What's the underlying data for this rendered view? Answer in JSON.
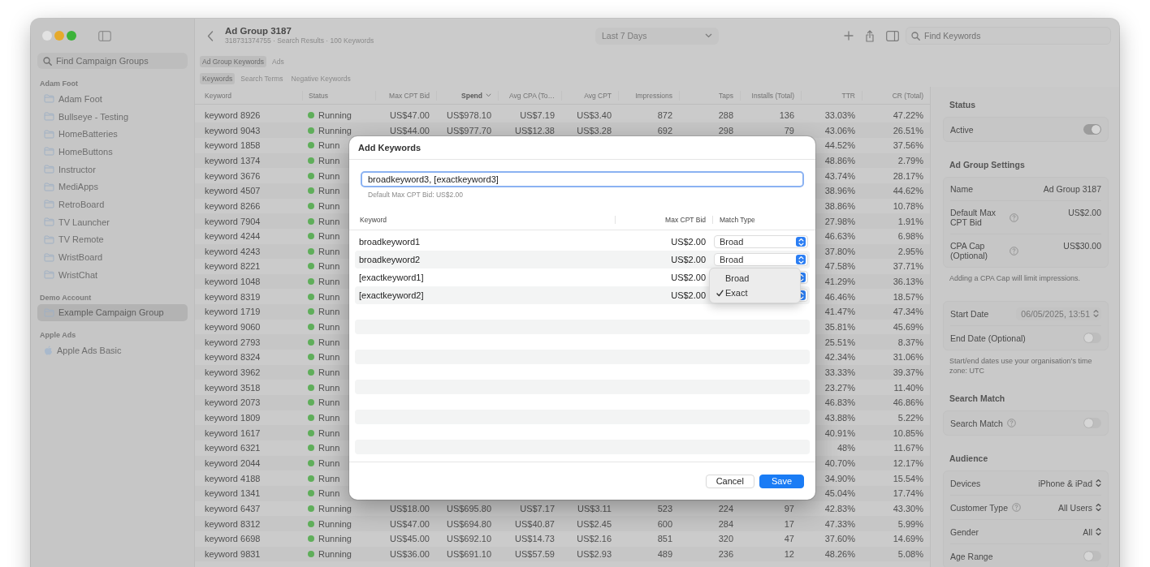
{
  "window": {
    "title": "Ad Group 3187",
    "subtitle": "318731374755 · Search Results · 100 Keywords"
  },
  "sidebar": {
    "search": {
      "placeholder": "Find Campaign Groups"
    },
    "sections": [
      {
        "title": "Adam Foot",
        "items": [
          {
            "label": "Adam Foot",
            "kind": "folder",
            "selected": false
          },
          {
            "label": "Bullseye - Testing",
            "kind": "folder",
            "selected": false
          },
          {
            "label": "HomeBatteries",
            "kind": "folder",
            "selected": false
          },
          {
            "label": "HomeButtons",
            "kind": "folder",
            "selected": false
          },
          {
            "label": "Instructor",
            "kind": "folder",
            "selected": false
          },
          {
            "label": "MediApps",
            "kind": "folder",
            "selected": false
          },
          {
            "label": "RetroBoard",
            "kind": "folder",
            "selected": false
          },
          {
            "label": "TV Launcher",
            "kind": "folder",
            "selected": false
          },
          {
            "label": "TV Remote",
            "kind": "folder",
            "selected": false
          },
          {
            "label": "WristBoard",
            "kind": "folder",
            "selected": false
          },
          {
            "label": "WristChat",
            "kind": "folder",
            "selected": false
          }
        ]
      },
      {
        "title": "Demo Account",
        "items": [
          {
            "label": "Example Campaign Group",
            "kind": "folder",
            "selected": true
          }
        ]
      },
      {
        "title": "Apple Ads",
        "items": [
          {
            "label": "Apple Ads Basic",
            "kind": "apple",
            "selected": false
          }
        ]
      }
    ]
  },
  "toolbar": {
    "date_range": "Last 7 Days",
    "search": {
      "placeholder": "Find Keywords"
    }
  },
  "tabs": [
    {
      "label": "Ad Group Keywords",
      "selected": true
    },
    {
      "label": "Ads",
      "selected": false
    }
  ],
  "subtabs": [
    {
      "label": "Keywords",
      "selected": true
    },
    {
      "label": "Search Terms",
      "selected": false
    },
    {
      "label": "Negative Keywords",
      "selected": false
    }
  ],
  "table": {
    "columns": [
      {
        "label": "Keyword",
        "sorted": false
      },
      {
        "label": "Status",
        "sorted": false
      },
      {
        "label": "Max CPT Bid",
        "sorted": false
      },
      {
        "label": "Spend",
        "sorted": true
      },
      {
        "label": "Avg CPA (To…",
        "sorted": false
      },
      {
        "label": "Avg CPT",
        "sorted": false
      },
      {
        "label": "Impressions",
        "sorted": false
      },
      {
        "label": "Taps",
        "sorted": false
      },
      {
        "label": "Installs (Total)",
        "sorted": false
      },
      {
        "label": "TTR",
        "sorted": false
      },
      {
        "label": "CR (Total)",
        "sorted": false
      }
    ],
    "rows": [
      {
        "keyword": "keyword 8926",
        "status": "Running",
        "max_cpt_bid": "US$47.00",
        "spend": "US$978.10",
        "avg_cpa": "US$7.19",
        "avg_cpt": "US$3.40",
        "impressions": "872",
        "taps": "288",
        "installs": "136",
        "ttr": "33.03%",
        "cr": "47.22%"
      },
      {
        "keyword": "keyword 9043",
        "status": "Running",
        "max_cpt_bid": "US$44.00",
        "spend": "US$977.70",
        "avg_cpa": "US$12.38",
        "avg_cpt": "US$3.28",
        "impressions": "692",
        "taps": "298",
        "installs": "79",
        "ttr": "43.06%",
        "cr": "26.51%"
      },
      {
        "keyword": "keyword 1858",
        "status": "Runn",
        "ttr": "44.52%",
        "cr": "37.56%"
      },
      {
        "keyword": "keyword 1374",
        "status": "Runn",
        "ttr": "48.86%",
        "cr": "2.79%"
      },
      {
        "keyword": "keyword 3676",
        "status": "Runn",
        "ttr": "43.74%",
        "cr": "28.17%"
      },
      {
        "keyword": "keyword 4507",
        "status": "Runn",
        "ttr": "38.96%",
        "cr": "44.62%"
      },
      {
        "keyword": "keyword 8266",
        "status": "Runn",
        "ttr": "38.86%",
        "cr": "10.78%"
      },
      {
        "keyword": "keyword 7904",
        "status": "Runn",
        "ttr": "27.98%",
        "cr": "1.91%"
      },
      {
        "keyword": "keyword 4244",
        "status": "Runn",
        "ttr": "46.63%",
        "cr": "6.98%"
      },
      {
        "keyword": "keyword 4243",
        "status": "Runn",
        "ttr": "37.80%",
        "cr": "2.95%"
      },
      {
        "keyword": "keyword 8221",
        "status": "Runn",
        "ttr": "47.58%",
        "cr": "37.71%"
      },
      {
        "keyword": "keyword 1048",
        "status": "Runn",
        "ttr": "41.29%",
        "cr": "36.13%"
      },
      {
        "keyword": "keyword 8319",
        "status": "Runn",
        "ttr": "46.46%",
        "cr": "18.57%"
      },
      {
        "keyword": "keyword 1719",
        "status": "Runn",
        "ttr": "41.47%",
        "cr": "47.34%"
      },
      {
        "keyword": "keyword 9060",
        "status": "Runn",
        "ttr": "35.81%",
        "cr": "45.69%"
      },
      {
        "keyword": "keyword 2793",
        "status": "Runn",
        "ttr": "25.51%",
        "cr": "8.37%"
      },
      {
        "keyword": "keyword 8324",
        "status": "Runn",
        "ttr": "42.34%",
        "cr": "31.06%"
      },
      {
        "keyword": "keyword 3962",
        "status": "Runn",
        "ttr": "33.33%",
        "cr": "39.37%"
      },
      {
        "keyword": "keyword 3518",
        "status": "Runn",
        "ttr": "23.27%",
        "cr": "11.40%"
      },
      {
        "keyword": "keyword 2073",
        "status": "Runn",
        "ttr": "46.83%",
        "cr": "46.86%"
      },
      {
        "keyword": "keyword 1809",
        "status": "Runn",
        "ttr": "43.88%",
        "cr": "5.22%"
      },
      {
        "keyword": "keyword 1617",
        "status": "Runn",
        "ttr": "40.91%",
        "cr": "10.85%"
      },
      {
        "keyword": "keyword 6321",
        "status": "Runn",
        "ttr": "48%",
        "cr": "11.67%"
      },
      {
        "keyword": "keyword 2044",
        "status": "Runn",
        "ttr": "40.70%",
        "cr": "12.17%"
      },
      {
        "keyword": "keyword 4188",
        "status": "Runn",
        "ttr": "34.90%",
        "cr": "15.54%"
      },
      {
        "keyword": "keyword 1341",
        "status": "Runn",
        "ttr": "45.04%",
        "cr": "17.74%"
      },
      {
        "keyword": "keyword 6437",
        "status": "Running",
        "max_cpt_bid": "US$18.00",
        "spend": "US$695.80",
        "avg_cpa": "US$7.17",
        "avg_cpt": "US$3.11",
        "impressions": "523",
        "taps": "224",
        "installs": "97",
        "ttr": "42.83%",
        "cr": "43.30%"
      },
      {
        "keyword": "keyword 8312",
        "status": "Running",
        "max_cpt_bid": "US$47.00",
        "spend": "US$694.80",
        "avg_cpa": "US$40.87",
        "avg_cpt": "US$2.45",
        "impressions": "600",
        "taps": "284",
        "installs": "17",
        "ttr": "47.33%",
        "cr": "5.99%"
      },
      {
        "keyword": "keyword 6698",
        "status": "Running",
        "max_cpt_bid": "US$45.00",
        "spend": "US$692.10",
        "avg_cpa": "US$14.73",
        "avg_cpt": "US$2.16",
        "impressions": "851",
        "taps": "320",
        "installs": "47",
        "ttr": "37.60%",
        "cr": "14.69%"
      },
      {
        "keyword": "keyword 9831",
        "status": "Running",
        "max_cpt_bid": "US$36.00",
        "spend": "US$691.10",
        "avg_cpa": "US$57.59",
        "avg_cpt": "US$2.93",
        "impressions": "489",
        "taps": "236",
        "installs": "12",
        "ttr": "48.26%",
        "cr": "5.08%"
      }
    ]
  },
  "inspector": {
    "sections": [
      {
        "title": "Status",
        "rows": [
          {
            "kind": "toggle",
            "label": "Active",
            "on": true
          }
        ]
      },
      {
        "title": "Ad Group Settings",
        "rows": [
          {
            "kind": "value",
            "label": "Name",
            "value": "Ad Group 3187"
          },
          {
            "kind": "value",
            "label": "Default Max CPT Bid",
            "help": true,
            "value": "US$2.00"
          },
          {
            "kind": "value",
            "label": "CPA Cap (Optional)",
            "help": true,
            "value": "US$30.00"
          }
        ],
        "note": "Adding a CPA Cap will limit impressions."
      },
      {
        "rows": [
          {
            "kind": "date",
            "label": "Start Date",
            "value": "06/05/2025, 13:51",
            "disabled": true
          },
          {
            "kind": "toggle",
            "label": "End Date (Optional)",
            "on": false
          }
        ],
        "note": "Start/end dates use your organisation’s time zone: UTC"
      },
      {
        "title": "Search Match",
        "rows": [
          {
            "kind": "toggle",
            "label": "Search Match",
            "help": true,
            "on": false
          }
        ]
      },
      {
        "title": "Audience",
        "rows": [
          {
            "kind": "popup",
            "label": "Devices",
            "value": "iPhone & iPad"
          },
          {
            "kind": "popup",
            "label": "Customer Type",
            "help": true,
            "value": "All Users"
          },
          {
            "kind": "popup",
            "label": "Gender",
            "value": "All"
          },
          {
            "kind": "toggle",
            "label": "Age Range",
            "on": false
          }
        ]
      }
    ]
  },
  "dialog": {
    "title": "Add Keywords",
    "input": {
      "value": "broadkeyword3, [exactkeyword3]"
    },
    "hint": "Default Max CPT Bid: US$2.00",
    "columns": [
      "Keyword",
      "Max CPT Bid",
      "Match Type"
    ],
    "rows": [
      {
        "keyword": "broadkeyword1",
        "bid": "US$2.00",
        "match_type": "Broad"
      },
      {
        "keyword": "broadkeyword2",
        "bid": "US$2.00",
        "match_type": "Broad"
      },
      {
        "keyword": "[exactkeyword1]",
        "bid": "US$2.00"
      },
      {
        "keyword": "[exactkeyword2]",
        "bid": "US$2.00"
      }
    ],
    "menu": [
      {
        "label": "Broad",
        "selected": false
      },
      {
        "label": "Exact",
        "selected": true
      }
    ],
    "buttons": [
      {
        "label": "Cancel",
        "kind": "secondary"
      },
      {
        "label": "Save",
        "kind": "primary"
      }
    ]
  }
}
